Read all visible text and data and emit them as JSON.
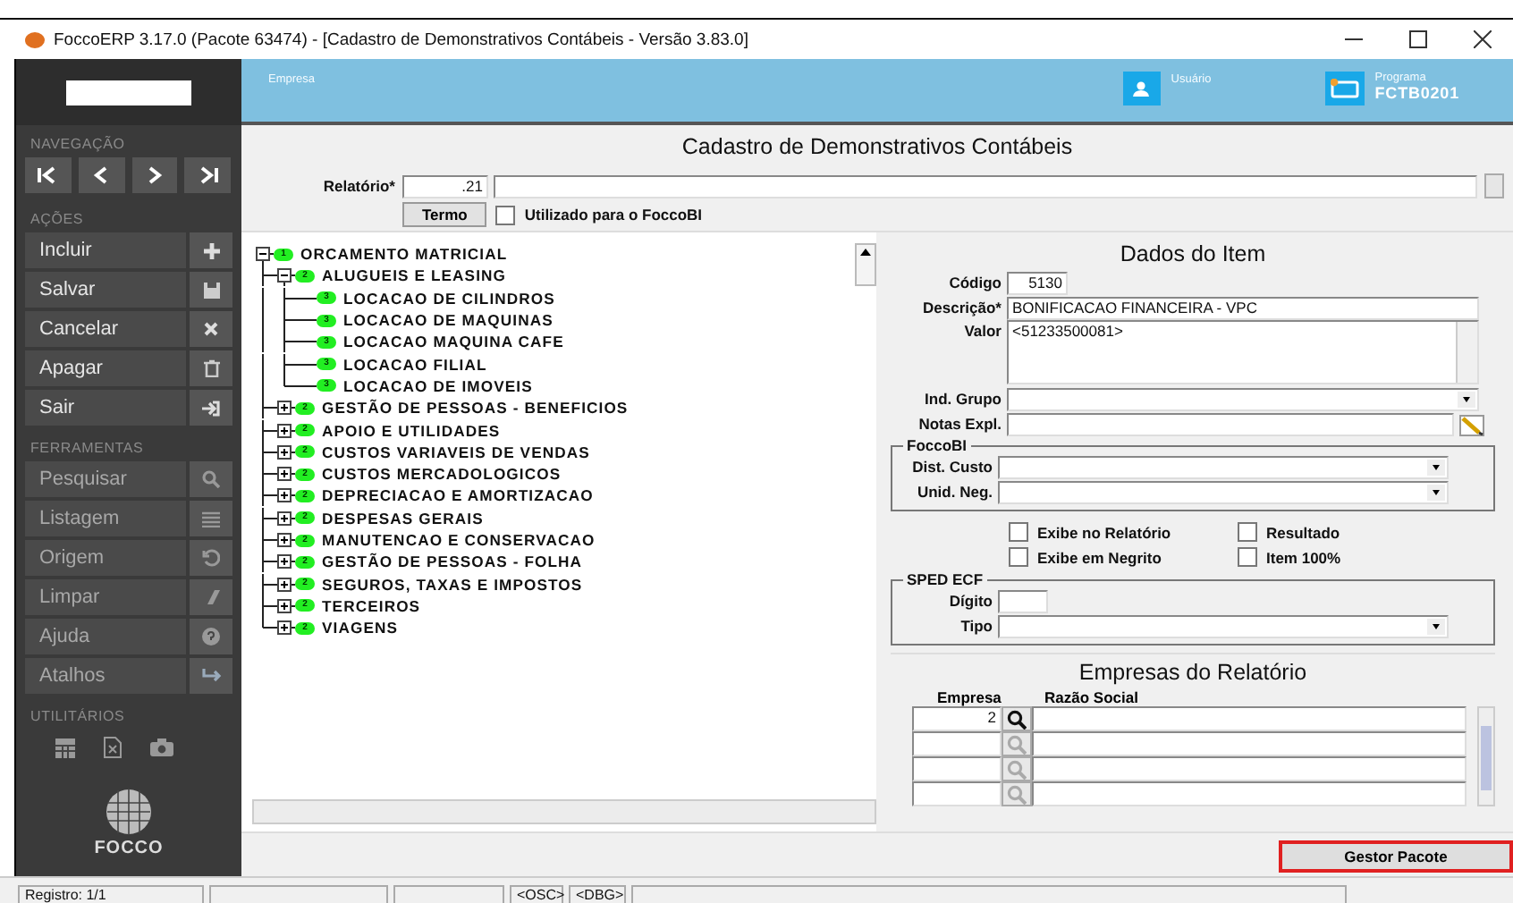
{
  "window": {
    "title": "FoccoERP 3.17.0 (Pacote 63474) - [Cadastro de Demonstrativos Contábeis - Versão 3.83.0]"
  },
  "sidebar": {
    "sections": [
      {
        "title": "NAVEGAÇÃO",
        "kind": "nav"
      },
      {
        "title": "AÇÕES",
        "kind": "actions",
        "items": [
          {
            "label": "Incluir"
          },
          {
            "label": "Salvar"
          },
          {
            "label": "Cancelar"
          },
          {
            "label": "Apagar"
          },
          {
            "label": "Sair"
          }
        ]
      },
      {
        "title": "FERRAMENTAS",
        "kind": "tools",
        "items": [
          {
            "label": "Pesquisar"
          },
          {
            "label": "Listagem"
          },
          {
            "label": "Origem"
          },
          {
            "label": "Limpar"
          },
          {
            "label": "Ajuda"
          },
          {
            "label": "Atalhos"
          }
        ]
      },
      {
        "title": "UTILITÁRIOS",
        "kind": "utilities"
      }
    ],
    "logo": "FOCCO"
  },
  "header": {
    "company_label": "Empresa",
    "user_label": "Usuário",
    "program_label": "Programa",
    "program_code": "FCTB0201"
  },
  "form": {
    "title": "Cadastro de Demonstrativos Contábeis",
    "report_label": "Relatório*",
    "report_code": ".21",
    "term_button": "Termo",
    "foccobi_check": {
      "label": "Utilizado para o FoccoBI",
      "checked": false
    }
  },
  "tree": [
    {
      "label": "ORCAMENTO MATRICIAL",
      "badge": "1",
      "expanded": true,
      "children": [
        {
          "label": "ALUGUEIS E LEASING",
          "badge": "2",
          "expanded": true,
          "children": [
            {
              "label": "LOCACAO DE CILINDROS",
              "badge": "3"
            },
            {
              "label": "LOCACAO DE MAQUINAS",
              "badge": "3"
            },
            {
              "label": "LOCACAO MAQUINA CAFE",
              "badge": "3"
            },
            {
              "label": "LOCACAO FILIAL",
              "badge": "3"
            },
            {
              "label": "LOCACAO DE IMOVEIS",
              "badge": "3"
            }
          ]
        },
        {
          "label": "GESTÃO DE PESSOAS - BENEFICIOS",
          "badge": "2",
          "expanded": false
        },
        {
          "label": "APOIO E UTILIDADES",
          "badge": "2",
          "expanded": false
        },
        {
          "label": "CUSTOS VARIAVEIS DE VENDAS",
          "badge": "2",
          "expanded": false
        },
        {
          "label": "CUSTOS MERCADOLOGICOS",
          "badge": "2",
          "expanded": false
        },
        {
          "label": "DEPRECIACAO E AMORTIZACAO",
          "badge": "2",
          "expanded": false
        },
        {
          "label": "DESPESAS GERAIS",
          "badge": "2",
          "expanded": false
        },
        {
          "label": "MANUTENCAO E CONSERVACAO",
          "badge": "2",
          "expanded": false
        },
        {
          "label": "GESTÃO DE PESSOAS - FOLHA",
          "badge": "2",
          "expanded": false
        },
        {
          "label": "SEGUROS, TAXAS E IMPOSTOS",
          "badge": "2",
          "expanded": false
        },
        {
          "label": "TERCEIROS",
          "badge": "2",
          "expanded": false
        },
        {
          "label": "VIAGENS",
          "badge": "2",
          "expanded": false
        }
      ]
    }
  ],
  "item": {
    "title": "Dados do Item",
    "fields": [
      {
        "label": "Código",
        "kind": "short",
        "value": "5130"
      },
      {
        "label": "Descrição*",
        "kind": "text",
        "value": "BONIFICACAO FINANCEIRA - VPC"
      },
      {
        "label": "Valor",
        "kind": "textarea",
        "value": "<51233500081>"
      },
      {
        "label": "Ind. Grupo",
        "kind": "select"
      },
      {
        "label": "Notas Expl.",
        "kind": "notes"
      }
    ],
    "foccobi": {
      "title": "FoccoBI",
      "fields": [
        {
          "label": "Dist. Custo",
          "kind": "select"
        },
        {
          "label": "Unid. Neg.",
          "kind": "select"
        }
      ]
    },
    "options": [
      {
        "label": "Exibe no Relatório",
        "checked": false
      },
      {
        "label": "Resultado",
        "checked": false
      },
      {
        "label": "Exibe em Negrito",
        "checked": false
      },
      {
        "label": "Item 100%",
        "checked": false
      }
    ],
    "sped_ecf": {
      "title": "SPED ECF",
      "fields": [
        {
          "label": "Dígito",
          "kind": "short"
        },
        {
          "label": "Tipo",
          "kind": "select"
        }
      ]
    }
  },
  "companies": {
    "title": "Empresas do Relatório",
    "columns": [
      "Empresa",
      "Razão Social"
    ],
    "rows": [
      {
        "empresa": "2",
        "lookup_enabled": true
      },
      {
        "lookup_enabled": false
      },
      {
        "lookup_enabled": false
      },
      {
        "lookup_enabled": false
      }
    ]
  },
  "footer": {
    "button": "Gestor Pacote",
    "highlighted": true
  },
  "status_bar": [
    {
      "kind": "text",
      "text": "Registro: 1/1"
    },
    {
      "kind": "blank"
    },
    {
      "kind": "blank"
    },
    {
      "kind": "text",
      "text": "<OSC>"
    },
    {
      "kind": "text",
      "text": "<DBG>"
    },
    {
      "kind": "blank"
    }
  ]
}
